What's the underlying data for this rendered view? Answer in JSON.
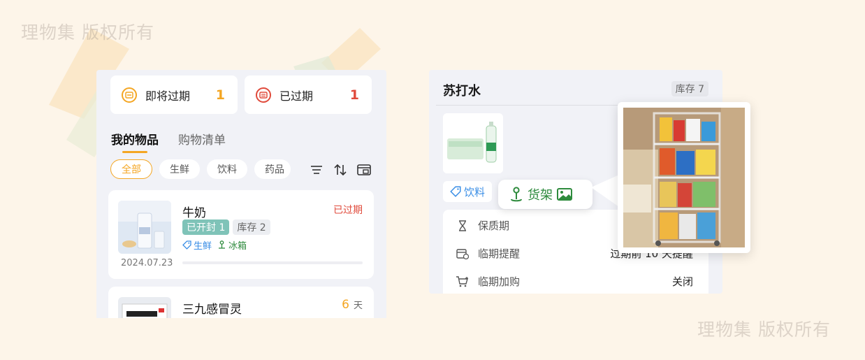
{
  "watermark": {
    "top_left": "理物集 版权所有",
    "bottom_right": "理物集 版权所有"
  },
  "colors": {
    "accent": "#f4a623",
    "expired_red": "#e04a3b",
    "teal_tag": "#7fc3b8",
    "green": "#2e8b3d",
    "blue": "#3a8ee6"
  },
  "left": {
    "stats": [
      {
        "label": "即将过期",
        "count": "1",
        "icon": "calendar-warning-icon"
      },
      {
        "label": "已过期",
        "count": "1",
        "icon": "calendar-expired-icon"
      }
    ],
    "tabs": [
      {
        "label": "我的物品",
        "active": true
      },
      {
        "label": "购物清单",
        "active": false
      }
    ],
    "chips": [
      {
        "label": "全部",
        "active": true
      },
      {
        "label": "生鲜"
      },
      {
        "label": "饮料"
      },
      {
        "label": "药品"
      }
    ],
    "toolbar_icons": [
      "filter-icon",
      "sort-icon",
      "layout-icon"
    ],
    "items": [
      {
        "name": "牛奶",
        "status": "已过期",
        "opened": "已开封 1",
        "stock": "库存 2",
        "category": "生鲜",
        "location": "冰箱",
        "date": "2024.07.23",
        "progress": 0
      },
      {
        "name": "三九感冒灵",
        "days": "6",
        "days_unit": "天"
      }
    ]
  },
  "right": {
    "title": "苏打水",
    "stock": "库存 7",
    "category": "饮料",
    "location": "货架",
    "rows": [
      {
        "label": "保质期",
        "icon": "hourglass-icon",
        "value": ""
      },
      {
        "label": "临期提醒",
        "icon": "calendar-reminder-icon",
        "value": "过期前 10 天提醒"
      },
      {
        "label": "临期加购",
        "icon": "cart-add-icon",
        "value": "关闭"
      }
    ]
  }
}
